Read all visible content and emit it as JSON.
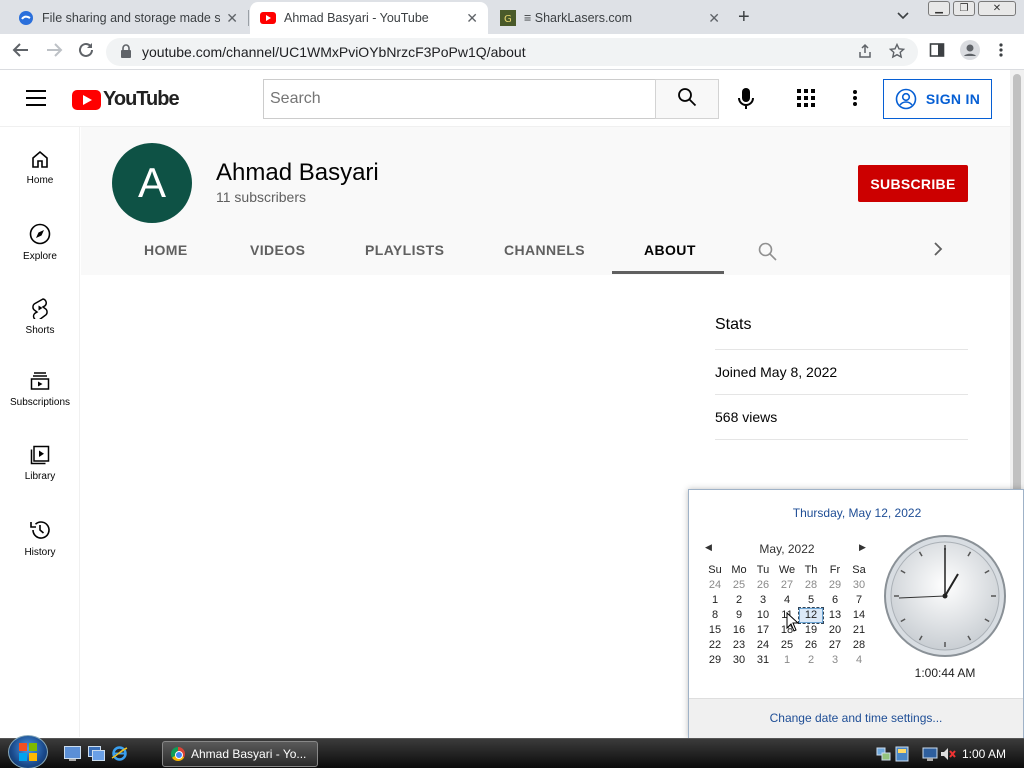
{
  "browser": {
    "tabs": [
      {
        "title": "File sharing and storage made si",
        "close": "✕"
      },
      {
        "title": "Ahmad Basyari - YouTube",
        "close": "✕"
      },
      {
        "title": "≡ SharkLasers.com",
        "close": "✕"
      }
    ],
    "new_tab": "+",
    "url": "youtube.com/channel/UC1WMxPviOYbNrzcF3PoPw1Q/about"
  },
  "youtube": {
    "logo_text": "YouTube",
    "search_placeholder": "Search",
    "sign_in_label": "SIGN IN",
    "sidebar": [
      {
        "label": "Home",
        "icon": "home-icon"
      },
      {
        "label": "Explore",
        "icon": "compass-icon"
      },
      {
        "label": "Shorts",
        "icon": "shorts-icon"
      },
      {
        "label": "Subscriptions",
        "icon": "subscriptions-icon"
      },
      {
        "label": "Library",
        "icon": "library-icon"
      },
      {
        "label": "History",
        "icon": "history-icon"
      }
    ],
    "channel": {
      "avatar_letter": "A",
      "avatar_color": "#0e5245",
      "name": "Ahmad Basyari",
      "subscribers": "11 subscribers",
      "subscribe_label": "SUBSCRIBE",
      "tabs": [
        "HOME",
        "VIDEOS",
        "PLAYLISTS",
        "CHANNELS",
        "ABOUT"
      ],
      "active_tab": "ABOUT"
    },
    "stats": {
      "title": "Stats",
      "joined": "Joined May 8, 2022",
      "views": "568 views"
    }
  },
  "calendar": {
    "full_date": "Thursday, May 12, 2022",
    "month_label": "May, 2022",
    "weekdays": [
      "Su",
      "Mo",
      "Tu",
      "We",
      "Th",
      "Fr",
      "Sa"
    ],
    "weeks": [
      [
        "24",
        "25",
        "26",
        "27",
        "28",
        "29",
        "30"
      ],
      [
        "1",
        "2",
        "3",
        "4",
        "5",
        "6",
        "7"
      ],
      [
        "8",
        "9",
        "10",
        "11",
        "12",
        "13",
        "14"
      ],
      [
        "15",
        "16",
        "17",
        "18",
        "19",
        "20",
        "21"
      ],
      [
        "22",
        "23",
        "24",
        "25",
        "26",
        "27",
        "28"
      ],
      [
        "29",
        "30",
        "31",
        "1",
        "2",
        "3",
        "4"
      ]
    ],
    "today": "12",
    "clock_time": "1:00:44 AM",
    "settings_link": "Change date and time settings..."
  },
  "taskbar": {
    "task_label": "Ahmad Basyari - Yo...",
    "time": "1:00 AM"
  }
}
